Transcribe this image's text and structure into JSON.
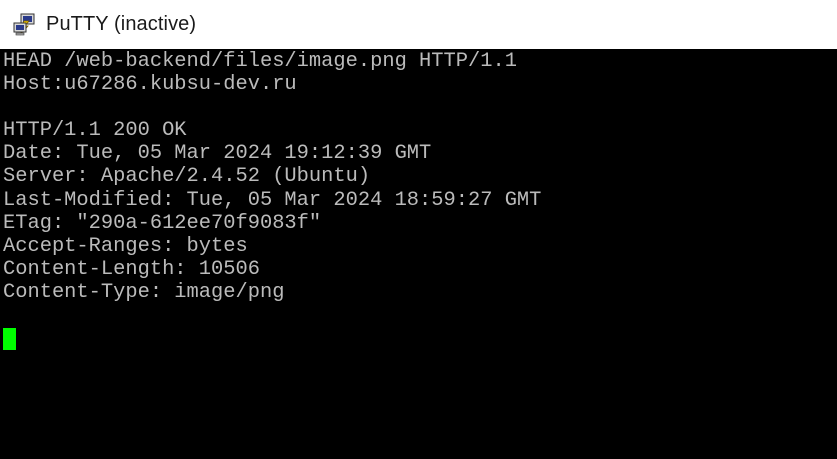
{
  "window": {
    "title": "PuTTY (inactive)",
    "icon": "putty-app-icon"
  },
  "terminal": {
    "lines": [
      "HEAD /web-backend/files/image.png HTTP/1.1",
      "Host:u67286.kubsu-dev.ru",
      "",
      "HTTP/1.1 200 OK",
      "Date: Tue, 05 Mar 2024 19:12:39 GMT",
      "Server: Apache/2.4.52 (Ubuntu)",
      "Last-Modified: Tue, 05 Mar 2024 18:59:27 GMT",
      "ETag: \"290a-612ee70f9083f\"",
      "Accept-Ranges: bytes",
      "Content-Length: 10506",
      "Content-Type: image/png",
      "",
      ""
    ],
    "text_color": "#bbbbbb",
    "background_color": "#000000",
    "cursor_color": "#00ff00"
  }
}
